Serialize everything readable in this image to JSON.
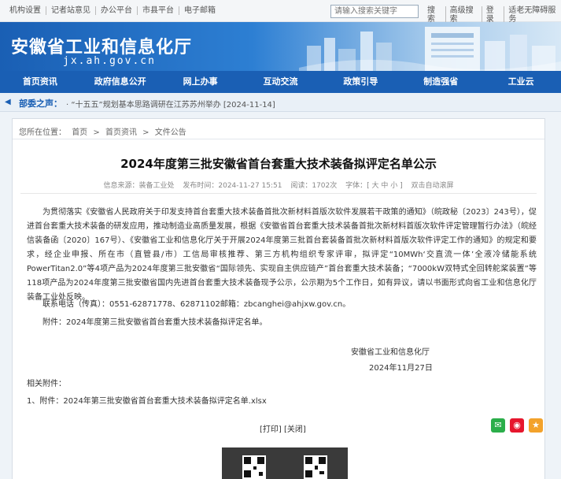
{
  "topbar": {
    "links": [
      "机构设置",
      "记者站意见",
      "办公平台",
      "市县平台",
      "电子邮箱"
    ],
    "search_placeholder": "请输入搜索关键字",
    "right_links": [
      "搜索",
      "高级搜索",
      "登录",
      "适老无障碍服务"
    ]
  },
  "header": {
    "title": "安徽省工业和信息化厅",
    "domain": "jx.ah.gov.cn"
  },
  "nav": {
    "items": [
      "首页资讯",
      "政府信息公开",
      "网上办事",
      "互动交流",
      "政策引导",
      "制造强省",
      "工业云"
    ]
  },
  "notice": {
    "label": "部委之声：",
    "text": "· “十五五”规划基本思路调研在江苏苏州举办 [2024-11-14]"
  },
  "breadcrumb": {
    "prefix": "您所在位置：",
    "items": [
      "首页",
      ">",
      "首页资讯",
      ">",
      "文件公告"
    ]
  },
  "article": {
    "title": "2024年度第三批安徽省首台套重大技术装备拟评定名单公示",
    "meta": [
      "信息来源：装备工业处",
      "发布时间：2024-11-27 15:51",
      "阅读：1702次",
      "字体：[ 大 中 小 ]",
      "双击自动滚屏"
    ],
    "body": "为贯彻落实《安徽省人民政府关于印发支持首台套重大技术装备首批次新材料首版次软件发展若干政策的通知》（皖政秘〔2023〕243号），促进首台套重大技术装备的研发应用，推动制造业高质量发展，根据《安徽省首台套重大技术装备首批次新材料首版次软件评定管理暂行办法》（皖经信装备函〔2020〕167号）、《安徽省工业和信息化厅关于开展2024年度第三批首台套装备首批次新材料首版次软件评定工作的通知》的规定和要求，经企业申报、所在市（直管县/市）工信局审核推荐、第三方机构组织专家评审，拟评定“10MWh‘交直流一体’全液冷储能系统PowerTitan2.0”等4项产品为2024年度第三批安徽省“国际领先、实现自主供应链产”首台套重大技术装备；“7000kW双特式全回转舵桨装置”等118项产品为2024年度第三批安徽省国内先进首台套重大技术装备现予公示，公示期为5个工作日，如有异议，请以书面形式向省工业和信息化厅装备工业处反映。",
    "contact": "联系电话（传真）：0551-62871778、62871102邮箱：zbcanghei@ahjxw.gov.cn。",
    "attachment_note": "附件：2024年度第三批安徽省首台套重大技术装备拟评定名单。",
    "sign_org": "安徽省工业和信息化厅",
    "sign_date": "2024年11月27日",
    "related_title": "相关附件：",
    "related_item": "1、附件：2024年第三批安徽省首台套重大技术装备拟评定名单.xlsx",
    "print_links": "[打印] [关闭]"
  },
  "share": {
    "icons": [
      "wechat-icon",
      "weibo-icon",
      "favorite-icon"
    ],
    "colors": [
      "#2bae4a",
      "#e6162d",
      "#f3a22b"
    ]
  },
  "colors": {
    "primary": "#1a5fb4",
    "nav_bg": "#1a5fb4"
  }
}
